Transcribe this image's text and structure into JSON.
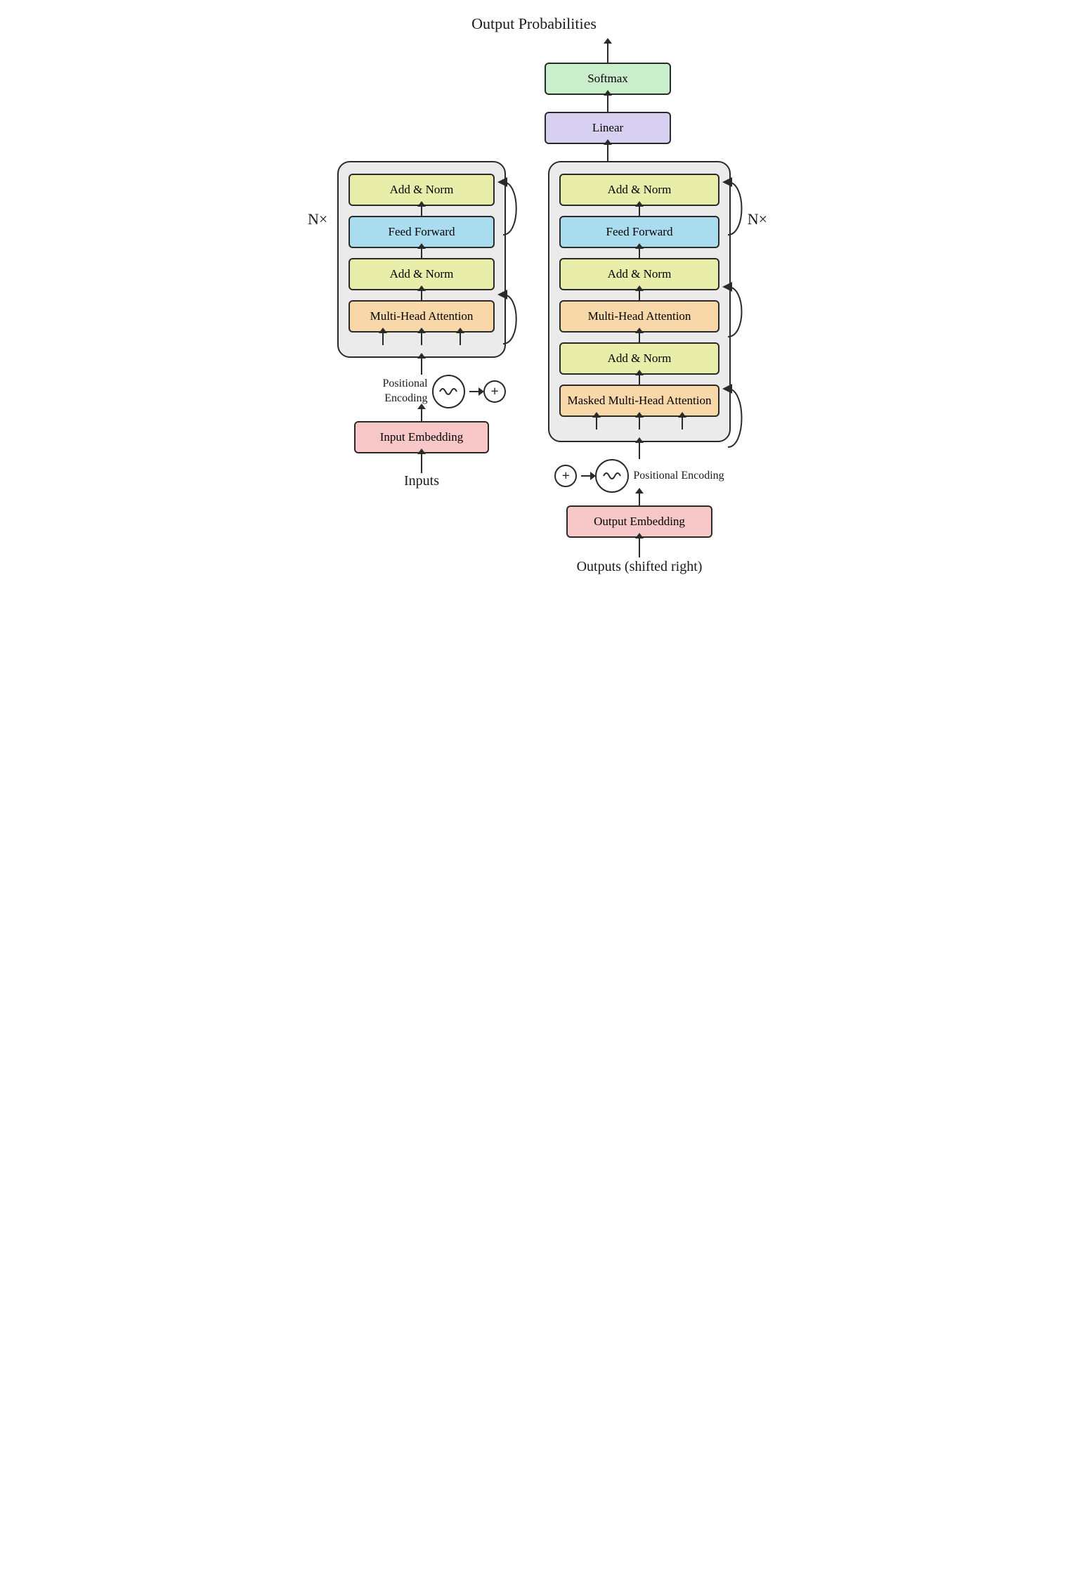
{
  "title": {
    "output_probabilities": "Output\nProbabilities"
  },
  "decoder_top": {
    "softmax": "Softmax",
    "linear": "Linear"
  },
  "encoder": {
    "nx_label": "N×",
    "add_norm_top": "Add & Norm",
    "feed_forward": "Feed\nForward",
    "add_norm_bottom": "Add & Norm",
    "multi_head_attention": "Multi-Head\nAttention",
    "positional_encoding": "Positional\nEncoding",
    "input_embedding": "Input\nEmbedding",
    "inputs_label": "Inputs"
  },
  "decoder": {
    "nx_label": "N×",
    "add_norm_top": "Add & Norm",
    "feed_forward": "Feed\nForward",
    "add_norm_mid": "Add & Norm",
    "multi_head_attention": "Multi-Head\nAttention",
    "add_norm_bottom": "Add & Norm",
    "masked_multi_head": "Masked\nMulti-Head\nAttention",
    "positional_encoding": "Positional\nEncoding",
    "output_embedding": "Output\nEmbedding",
    "outputs_label": "Outputs\n(shifted right)"
  },
  "colors": {
    "pink": "#f8c8c8",
    "yellow_green": "#e6ee9c",
    "blue": "#aadcf0",
    "orange": "#f8d8a8",
    "lavender": "#d0c8f0",
    "mint": "#c8eecc",
    "box_border": "#2a2a2a",
    "repeat_bg": "#ebebeb"
  }
}
